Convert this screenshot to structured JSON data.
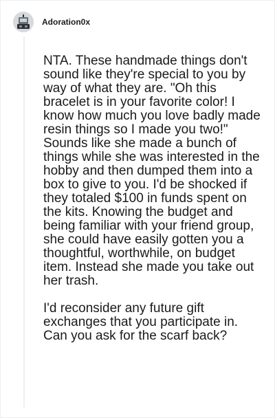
{
  "comment": {
    "username": "Adoration0x",
    "avatar_icon": "robot-avatar-icon",
    "paragraphs": [
      "NTA. These handmade things don't sound like they're special to you by way of what they are. \"Oh this bracelet is in your favorite color! I know how much you love badly made resin things so I made you two!\" Sounds like she made a bunch of things while she was interested in the hobby and then dumped them into a box to give to you. I'd be shocked if they totaled $100 in funds spent on the kits. Knowing the budget and being familiar with your friend group, she could have easily gotten you a thoughtful, worthwhile, on budget item. Instead she made you take out her trash.",
      "I'd reconsider any future gift exchanges that you participate in. Can you ask for the scarf back?"
    ]
  },
  "colors": {
    "text": "#1a1a1b",
    "thread_line": "#edeff1",
    "background": "#ffffff"
  }
}
